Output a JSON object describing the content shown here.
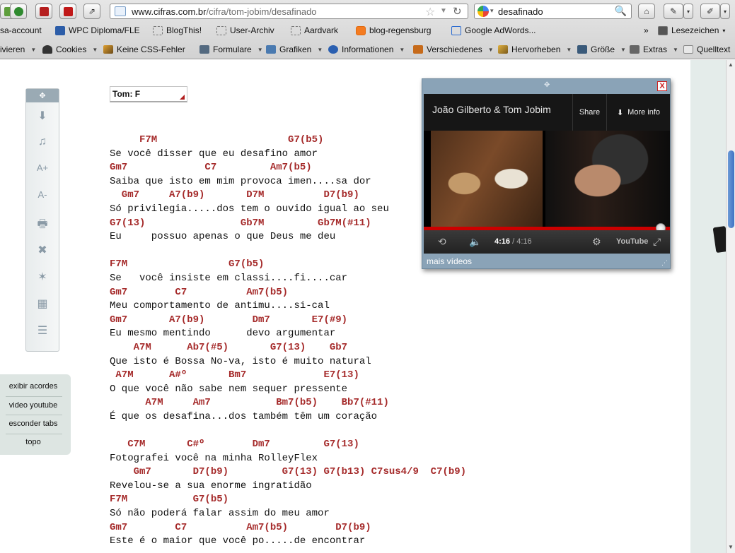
{
  "browser": {
    "url_domain": "www.cifras.com.br",
    "url_path": "/cifra/tom-jobim/desafinado",
    "search_query": "desafinado",
    "bookmarks": [
      "sa-account",
      "WPC Diploma/FLE",
      "BlogThis!",
      "User-Archiv",
      "Aardvark",
      "blog-regensburg",
      "Google AdWords...",
      "Lesezeichen"
    ],
    "bookmarks_overflow": "»",
    "toolbar_items": [
      "ivieren",
      "Cookies",
      "Keine CSS-Fehler",
      "Formulare",
      "Grafiken",
      "Informationen",
      "Verschiedenes",
      "Hervorheben",
      "Größe",
      "Extras",
      "Quelltext"
    ]
  },
  "page": {
    "tom_label": "Tom:  F",
    "side_links": [
      "exibir acordes",
      "video youtube",
      "esconder tabs",
      "topo"
    ],
    "tool_icons": [
      "move-icon",
      "download-icon",
      "music-note-icon",
      "font-increase-icon",
      "font-decrease-icon",
      "print-icon",
      "close-icon",
      "sparkle-icon",
      "chord-grid-icon",
      "list-icon"
    ],
    "tool_glyphs": [
      "⬇",
      "♫",
      "A+",
      "A-",
      "🖶",
      "✖",
      "✶",
      "▦",
      "☰"
    ]
  },
  "song": {
    "lines": [
      {
        "t": "c",
        "text": "     F7M                      G7(b5)"
      },
      {
        "t": "l",
        "text": "Se você disser que eu desafino amor"
      },
      {
        "t": "c",
        "text": "Gm7             C7         Am7(b5)"
      },
      {
        "t": "l",
        "text": "Saiba que isto em mim provoca imen....sa dor"
      },
      {
        "t": "c",
        "text": "  Gm7     A7(b9)       D7M          D7(b9)"
      },
      {
        "t": "l",
        "text": "Só privilegia.....dos tem o ouvido igual ao seu"
      },
      {
        "t": "c",
        "text": "G7(13)                Gb7M         Gb7M(#11)"
      },
      {
        "t": "l",
        "text": "Eu     possuo apenas o que Deus me deu"
      },
      {
        "t": "b",
        "text": ""
      },
      {
        "t": "c",
        "text": "F7M                 G7(b5)"
      },
      {
        "t": "l",
        "text": "Se   você insiste em classi....fi....car"
      },
      {
        "t": "c",
        "text": "Gm7        C7          Am7(b5)"
      },
      {
        "t": "l",
        "text": "Meu comportamento de antimu....si-cal"
      },
      {
        "t": "c",
        "text": "Gm7       A7(b9)        Dm7       E7(#9)"
      },
      {
        "t": "l",
        "text": "Eu mesmo mentindo      devo argumentar"
      },
      {
        "t": "c",
        "text": "    A7M      Ab7(#5)       G7(13)    Gb7"
      },
      {
        "t": "l",
        "text": "Que isto é Bossa No-va, isto é muito natural"
      },
      {
        "t": "c",
        "text": " A7M      A#º       Bm7             E7(13)"
      },
      {
        "t": "l",
        "text": "O que você não sabe nem sequer pressente"
      },
      {
        "t": "c",
        "text": "      A7M     Am7           Bm7(b5)    Bb7(#11)"
      },
      {
        "t": "l",
        "text": "É que os desafina...dos também têm um coração"
      },
      {
        "t": "b",
        "text": ""
      },
      {
        "t": "c",
        "text": "   C7M       C#º        Dm7         G7(13)"
      },
      {
        "t": "l",
        "text": "Fotografei você na minha RolleyFlex"
      },
      {
        "t": "c",
        "text": "    Gm7       D7(b9)         G7(13) G7(b13) C7sus4/9  C7(b9)"
      },
      {
        "t": "l",
        "text": "Revelou-se a sua enorme ingratidão"
      },
      {
        "t": "c",
        "text": "F7M           G7(b5)"
      },
      {
        "t": "l",
        "text": "Só não poderá falar assim do meu amor"
      },
      {
        "t": "c",
        "text": "Gm7        C7          Am7(b5)        D7(b9)"
      },
      {
        "t": "l",
        "text": "Este é o maior que você po.....de encontrar"
      }
    ]
  },
  "video": {
    "title": "João Gilberto & Tom Jobim",
    "share": "Share",
    "more_info": "More info",
    "time_current": "4:16",
    "time_total": " / 4:16",
    "youtube_label": "YouTube",
    "mais_videos": "mais vídeos",
    "close_label": "X",
    "progress": 1.0,
    "colors": {
      "progress": "#cc0000",
      "popup_bg": "#8aa3b7"
    }
  },
  "colors": {
    "chord": "#a52a2a",
    "side_panel": "#dde5e2"
  }
}
